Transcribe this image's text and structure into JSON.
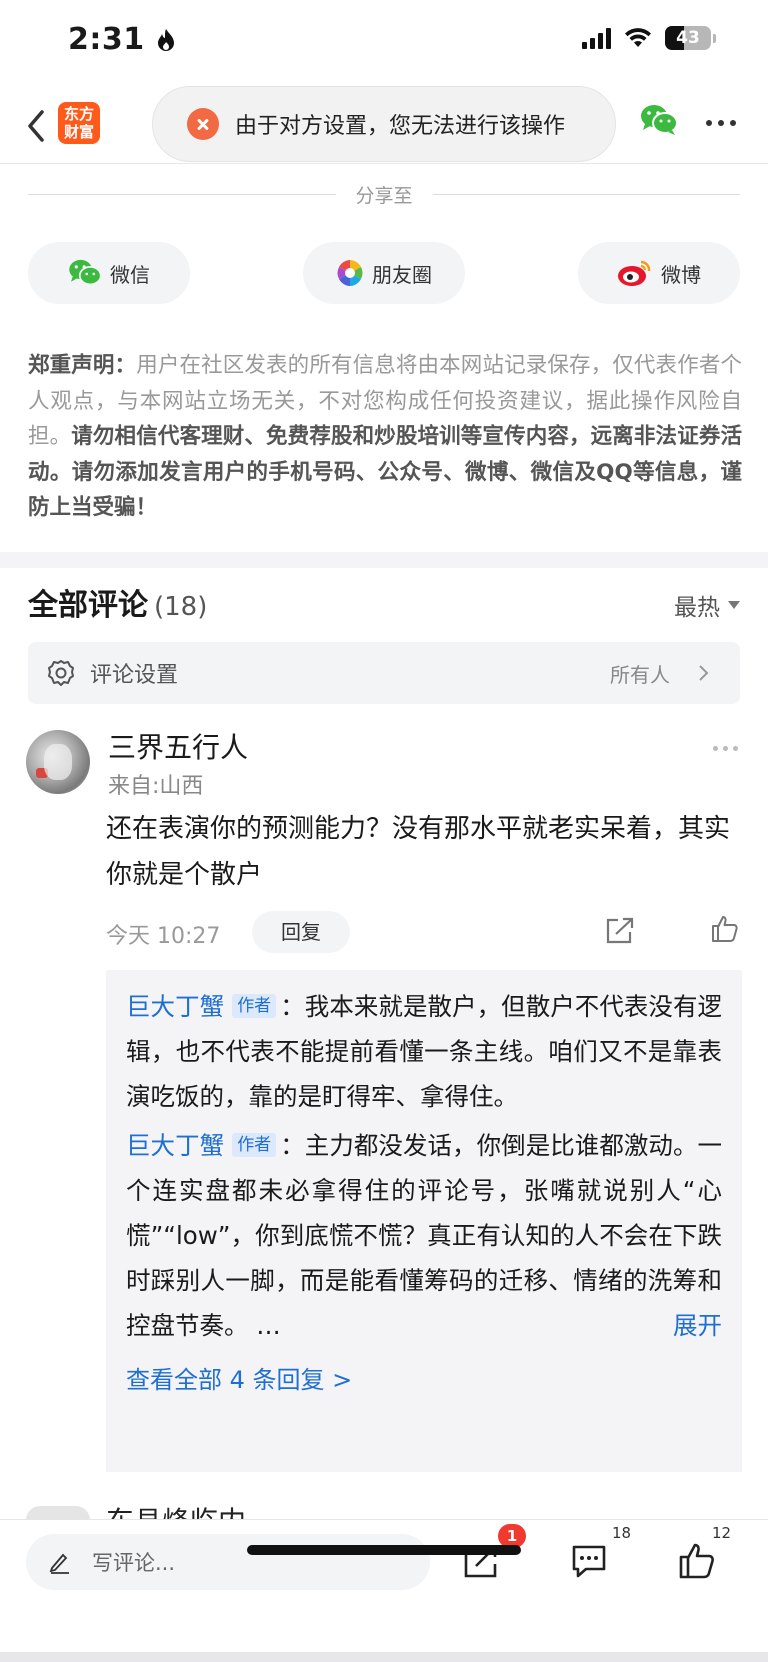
{
  "status_bar": {
    "time": "2:31",
    "battery": "43"
  },
  "header": {
    "logo_line1": "东方",
    "logo_line2": "财富",
    "toast_text": "由于对方设置，您无法进行该操作"
  },
  "share": {
    "title": "分享至",
    "buttons": [
      {
        "label": "微信",
        "icon": "wechat-icon"
      },
      {
        "label": "朋友圈",
        "icon": "moments-icon"
      },
      {
        "label": "微博",
        "icon": "weibo-icon"
      }
    ]
  },
  "disclaimer": {
    "lead": "郑重声明：",
    "normal": "用户在社区发表的所有信息将由本网站记录保存，仅代表作者个人观点，与本网站立场无关，不对您构成任何投资建议，据此操作风险自担。",
    "bold": "请勿相信代客理财、免费荐股和炒股培训等宣传内容，远离非法证券活动。请勿添加发言用户的手机号码、公众号、微博、微信及QQ等信息，谨防上当受骗！"
  },
  "comments": {
    "title": "全部评论",
    "count": "(18)",
    "sort": "最热",
    "settings_label": "评论设置",
    "settings_value": "所有人",
    "items": [
      {
        "user": "三界五行人",
        "location": "来自:山西",
        "text": "还在表演你的预测能力？没有那水平就老实呆着，其实你就是个散户",
        "time": "今天 10:27",
        "reply_label": "回复",
        "replies": [
          {
            "author": "巨大丁蟹",
            "tag": "作者",
            "sep": "：",
            "text": "我本来就是散户，但散户不代表没有逻辑，也不代表不能提前看懂一条主线。咱们又不是靠表演吃饭的，靠的是盯得牢、拿得住。"
          },
          {
            "author": "巨大丁蟹",
            "tag": "作者",
            "sep": "：",
            "text": "主力都没发话，你倒是比谁都激动。一个连实盘都未必拿得住的评论号，张嘴就说别人“心慌”“low”，你到底慌不慌？真正有认知的人不会在下跌时踩别人一脚，而是能看懂筹码的迁移、情绪的洗筹和控盘节奏。 …",
            "expand": "展开"
          }
        ],
        "view_all": "查看全部 4 条回复 >"
      }
    ],
    "next_user_partial": "东县烽临内"
  },
  "bottom_bar": {
    "input_placeholder": "写评论...",
    "share_badge": "1",
    "comment_count": "18",
    "like_count": "12"
  }
}
